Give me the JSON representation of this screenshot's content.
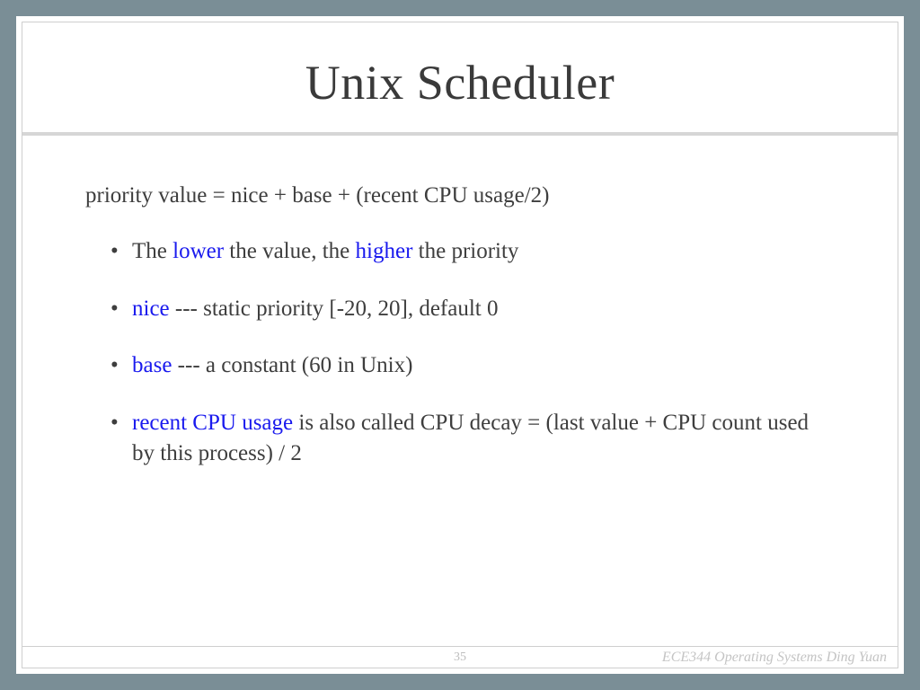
{
  "title": "Unix Scheduler",
  "formula": "priority value = nice + base + (recent CPU usage/2)",
  "bullets": [
    {
      "segments": [
        {
          "t": "The ",
          "hl": false
        },
        {
          "t": "lower",
          "hl": true
        },
        {
          "t": " the value, the ",
          "hl": false
        },
        {
          "t": "higher",
          "hl": true
        },
        {
          "t": " the priority",
          "hl": false
        }
      ]
    },
    {
      "segments": [
        {
          "t": "nice",
          "hl": true
        },
        {
          "t": " --- static priority [-20, 20], default 0",
          "hl": false
        }
      ]
    },
    {
      "segments": [
        {
          "t": "base",
          "hl": true
        },
        {
          "t": " --- a constant (60 in Unix)",
          "hl": false
        }
      ]
    },
    {
      "segments": [
        {
          "t": "recent CPU usage",
          "hl": true
        },
        {
          "t": " is also called CPU decay = (last value + CPU count used by this process) / 2",
          "hl": false
        }
      ]
    }
  ],
  "page_number": "35",
  "footer_text": "ECE344 Operating Systems Ding Yuan"
}
